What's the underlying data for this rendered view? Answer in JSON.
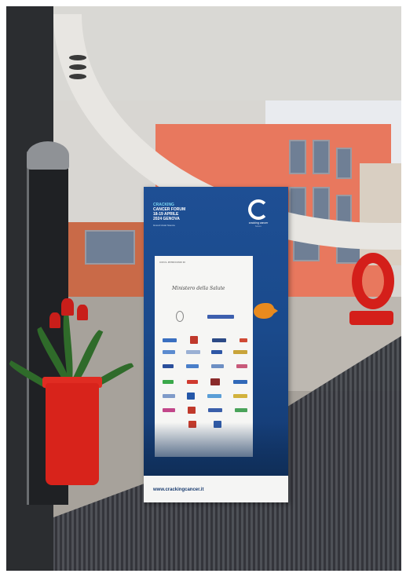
{
  "scene": "photo",
  "banner": {
    "headline": [
      "CRACKING",
      "CANCER FORUM",
      "18-19 APRILE",
      "2024 GENOVA"
    ],
    "subline": "Grand Hotel Savoia",
    "logo_name": "cracking cancer",
    "logo_tag": "forum",
    "panel_title": "CON IL PATROCINIO DI",
    "ministry_text": "Ministero della Salute",
    "footer_url": "www.crackingcancer.it"
  },
  "colors": {
    "banner_blue": "#1e4f94",
    "accent_cyan": "#79d3f0",
    "sculpture_red": "#d41f1a",
    "planter_red": "#d8231b",
    "building_salmon": "#e8785e"
  },
  "icons": [
    "crackingcancer-logo-icon",
    "fish-icon",
    "red-c-sculpture-icon",
    "flower-planter-icon"
  ]
}
